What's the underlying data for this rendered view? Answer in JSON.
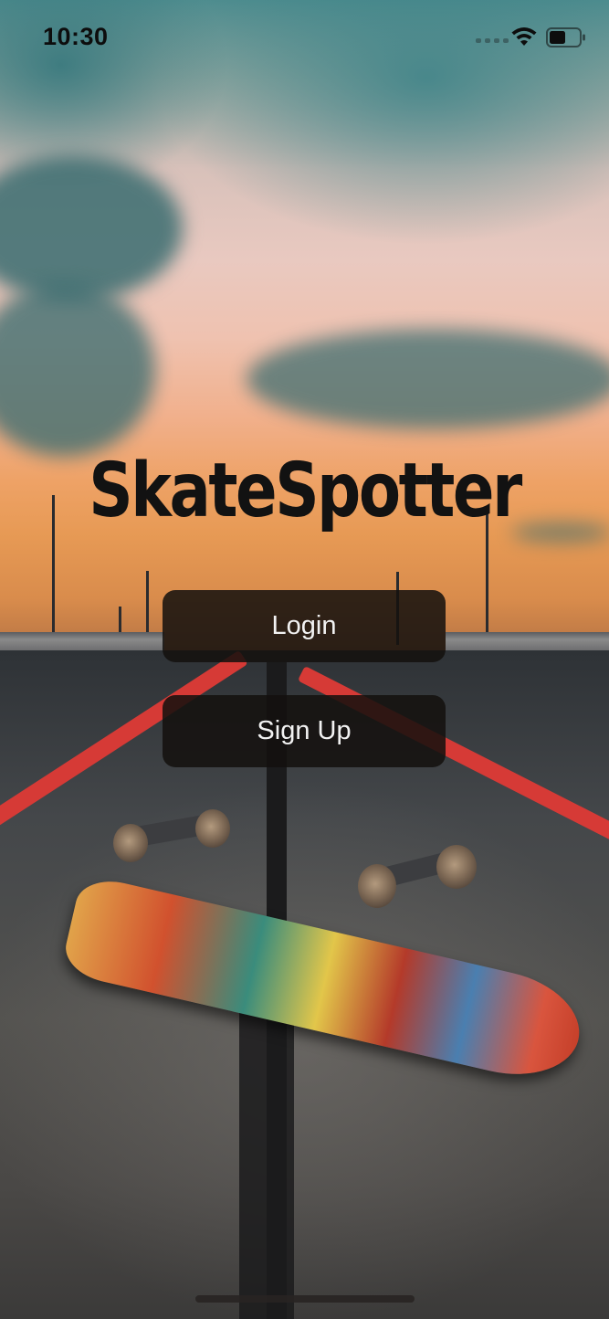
{
  "status_bar": {
    "time": "10:30",
    "icons": [
      "cellular-signal-icon",
      "wifi-icon",
      "battery-icon"
    ]
  },
  "app": {
    "title": "SkateSpotter"
  },
  "buttons": {
    "login_label": "Login",
    "signup_label": "Sign Up"
  },
  "colors": {
    "title": "#121212",
    "button_background": "#14100e",
    "button_text": "#f2f2f2",
    "road_stripe": "#d63a36"
  }
}
